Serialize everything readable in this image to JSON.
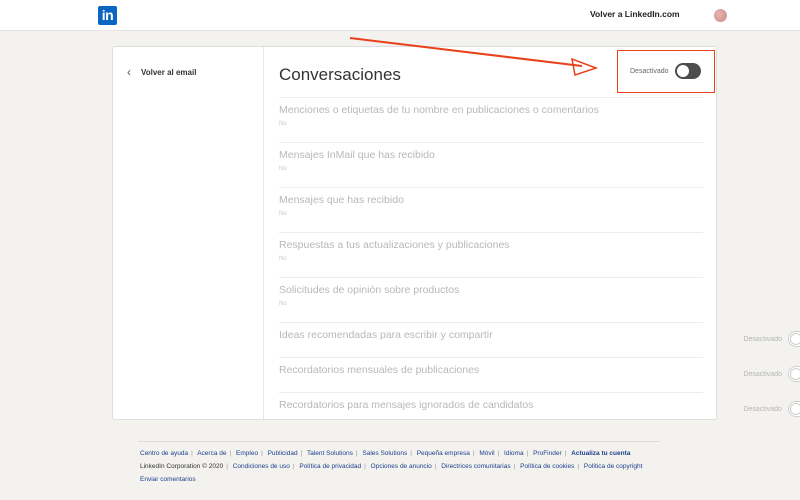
{
  "header": {
    "logo": "in",
    "back_link": "Volver a LinkedIn.com"
  },
  "sidebar": {
    "back_label": "Volver al email"
  },
  "main": {
    "title": "Conversaciones",
    "master_toggle_state": "Desactivado",
    "rows": [
      {
        "label": "Menciones o etiquetas de tu nombre en publicaciones o comentarios",
        "sub": "No",
        "kind": "edit"
      },
      {
        "label": "Mensajes InMail que has recibido",
        "sub": "No",
        "kind": "edit"
      },
      {
        "label": "Mensajes que has recibido",
        "sub": "No",
        "kind": "edit"
      },
      {
        "label": "Respuestas a tus actualizaciones y publicaciones",
        "sub": "No",
        "kind": "edit"
      },
      {
        "label": "Solicitudes de opinión sobre productos",
        "sub": "No",
        "kind": "edit"
      },
      {
        "label": "Ideas recomendadas para escribir y compartir",
        "state": "Desactivado",
        "kind": "toggle"
      },
      {
        "label": "Recordatorios mensuales de publicaciones",
        "state": "Desactivado",
        "kind": "toggle"
      },
      {
        "label": "Recordatorios para mensajes ignorados de candidatos",
        "state": "Desactivado",
        "kind": "toggle"
      }
    ]
  },
  "footer": {
    "links_row1": [
      "Centro de ayuda",
      "Acerca de",
      "Empleo",
      "Publicidad",
      "Talent Solutions",
      "Sales Solutions",
      "Pequeña empresa",
      "Móvil",
      "Idioma",
      "ProFinder",
      "Actualiza tu cuenta"
    ],
    "copyright": "LinkedIn Corporation © 2020",
    "links_row2": [
      "Condiciones de uso",
      "Política de privacidad",
      "Opciones de anuncio",
      "Directrices comunitarias",
      "Política de cookies",
      "Política de copyright"
    ],
    "feedback": "Enviar comentarios"
  },
  "colors": {
    "brand": "#0a66c2",
    "annotation": "#e8411b",
    "link": "#1b3f8b"
  }
}
